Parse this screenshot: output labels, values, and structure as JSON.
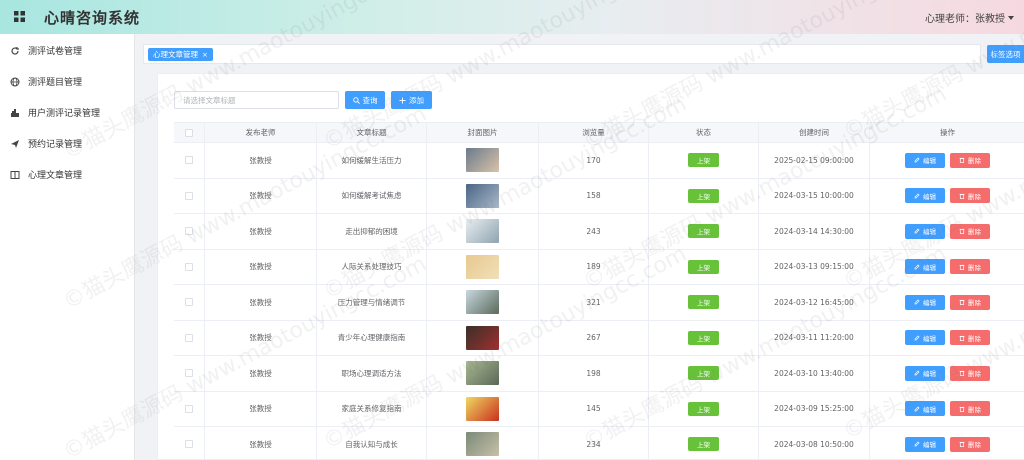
{
  "header": {
    "title": "心晴咨询系统",
    "user_label": "心理老师：张教授"
  },
  "sidebar": {
    "items": [
      {
        "label": "测评试卷管理",
        "icon": "refresh-icon"
      },
      {
        "label": "测评题目管理",
        "icon": "globe-icon"
      },
      {
        "label": "用户测评记录管理",
        "icon": "stamp-icon"
      },
      {
        "label": "预约记录管理",
        "icon": "send-icon"
      },
      {
        "label": "心理文章管理",
        "icon": "book-icon"
      }
    ]
  },
  "tabs": {
    "active_tab": "心理文章管理",
    "close_symbol": "×",
    "right_button": "标签选项"
  },
  "toolbar": {
    "search_placeholder": "请选择文章标题",
    "query_label": "查询",
    "add_label": "添加"
  },
  "table": {
    "headers": [
      "发布老师",
      "文章标题",
      "封面图片",
      "浏览量",
      "状态",
      "创建时间",
      "操作"
    ],
    "status_label": "上架",
    "edit_label": "编辑",
    "delete_label": "删除",
    "rows": [
      {
        "teacher": "张教授",
        "title": "如何缓解生活压力",
        "views": "170",
        "created": "2025-02-15 09:00:00",
        "thumb": [
          "#6a7a8c",
          "#d9c3a8"
        ]
      },
      {
        "teacher": "张教授",
        "title": "如何缓解考试焦虑",
        "views": "158",
        "created": "2024-03-15 10:00:00",
        "thumb": [
          "#4a6585",
          "#a8b8c8"
        ]
      },
      {
        "teacher": "张教授",
        "title": "走出抑郁的困境",
        "views": "243",
        "created": "2024-03-14 14:30:00",
        "thumb": [
          "#e8eef0",
          "#8fa3b0"
        ]
      },
      {
        "teacher": "张教授",
        "title": "人际关系处理技巧",
        "views": "189",
        "created": "2024-03-13 09:15:00",
        "thumb": [
          "#e8c890",
          "#f0e0b8"
        ]
      },
      {
        "teacher": "张教授",
        "title": "压力管理与情绪调节",
        "views": "321",
        "created": "2024-03-12 16:45:00",
        "thumb": [
          "#c8d8e0",
          "#5a6a5a"
        ]
      },
      {
        "teacher": "张教授",
        "title": "青少年心理健康指南",
        "views": "267",
        "created": "2024-03-11 11:20:00",
        "thumb": [
          "#3a3028",
          "#a03030"
        ]
      },
      {
        "teacher": "张教授",
        "title": "职场心理调适方法",
        "views": "198",
        "created": "2024-03-10 13:40:00",
        "thumb": [
          "#a8b890",
          "#5a6858"
        ]
      },
      {
        "teacher": "张教授",
        "title": "家庭关系修复指南",
        "views": "145",
        "created": "2024-03-09 15:25:00",
        "thumb": [
          "#f0d860",
          "#c83020"
        ]
      },
      {
        "teacher": "张教授",
        "title": "自我认知与成长",
        "views": "234",
        "created": "2024-03-08 10:50:00",
        "thumb": [
          "#7a8a78",
          "#c8c0a8"
        ]
      }
    ]
  },
  "watermark": "©猫头鹰源码 www.maotouyingcc.com",
  "colors": {
    "primary": "#409eff",
    "success": "#67c23a",
    "danger": "#f56c6c"
  }
}
